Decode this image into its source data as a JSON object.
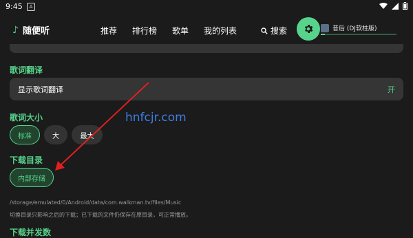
{
  "status_bar": {
    "time": "9:45",
    "app_icon_letter": "A"
  },
  "header": {
    "app_name": "随便听",
    "tabs": [
      "推荐",
      "排行榜",
      "歌单",
      "我的列表"
    ],
    "search_label": "搜索",
    "now_playing_title": "昔后 (DJ软柱版)",
    "progress_fraction": 0.05
  },
  "settings": {
    "lyrics_translation": {
      "section_label": "歌词翻译",
      "row_label": "显示歌词翻译",
      "row_value": "开"
    },
    "lyrics_size": {
      "section_label": "歌词大小",
      "options": [
        "标准",
        "大",
        "最大"
      ],
      "selected": "标准"
    },
    "download_dir": {
      "section_label": "下载目录",
      "option": "内部存储",
      "path": "/storage/emulated/0/Android/data/com.walkman.tv/files/Music",
      "note": "切换目录只影响之后的下载；已下载的文件仍保存在原目录，可正常播放。"
    },
    "next_section_label": "下载并发数"
  },
  "watermark": "hnfcjr.com",
  "colors": {
    "accent": "#57d38c",
    "annotation_arrow": "#e02020",
    "background": "#1b1b1b",
    "card": "#353535"
  }
}
